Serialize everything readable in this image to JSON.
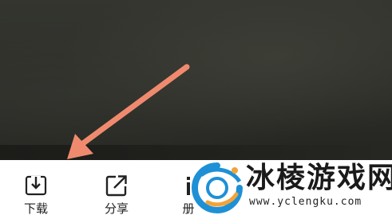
{
  "toolbar": {
    "items": [
      {
        "label": "下载",
        "icon": "download-icon"
      },
      {
        "label": "分享",
        "icon": "share-icon"
      },
      {
        "label": "册",
        "icon": "album-icon"
      }
    ]
  },
  "annotation": {
    "arrow_color": "#f08a6e",
    "points_to": "download"
  },
  "watermark": {
    "title": "冰棱游戏网",
    "url": "www.yclengku.com",
    "logo_colors": [
      "#1e90d6",
      "#f2a33a"
    ]
  }
}
